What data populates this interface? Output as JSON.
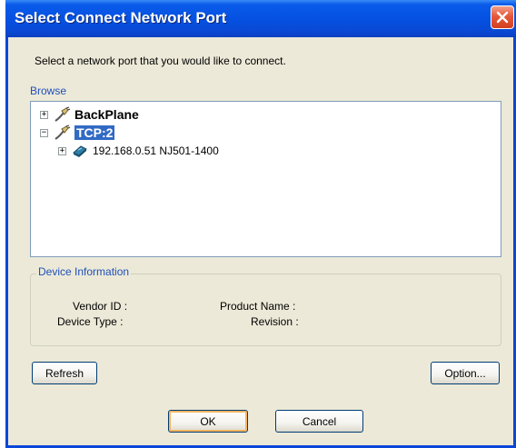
{
  "window": {
    "title": "Select Connect Network Port",
    "close_icon": "close-icon"
  },
  "instruction": "Select a network port that you would like to connect.",
  "browse": {
    "label": "Browse",
    "tree": [
      {
        "label": "BackPlane",
        "expander": "+",
        "icon": "network-port-icon",
        "selected": false
      },
      {
        "label": "TCP:2",
        "expander": "−",
        "icon": "network-port-icon",
        "selected": true
      },
      {
        "label": "192.168.0.51 NJ501-1400",
        "expander": "+",
        "icon": "plc-device-icon",
        "selected": false
      }
    ]
  },
  "device_info": {
    "label": "Device Information",
    "vendor_id_label": "Vendor ID :",
    "device_type_label": "Device Type :",
    "product_name_label": "Product Name :",
    "revision_label": "Revision :"
  },
  "buttons": {
    "refresh": "Refresh",
    "option": "Option...",
    "ok": "OK",
    "cancel": "Cancel"
  },
  "colors": {
    "titlebar": "#0550e0",
    "selection": "#316ac5",
    "group_label": "#1f4fb8"
  }
}
